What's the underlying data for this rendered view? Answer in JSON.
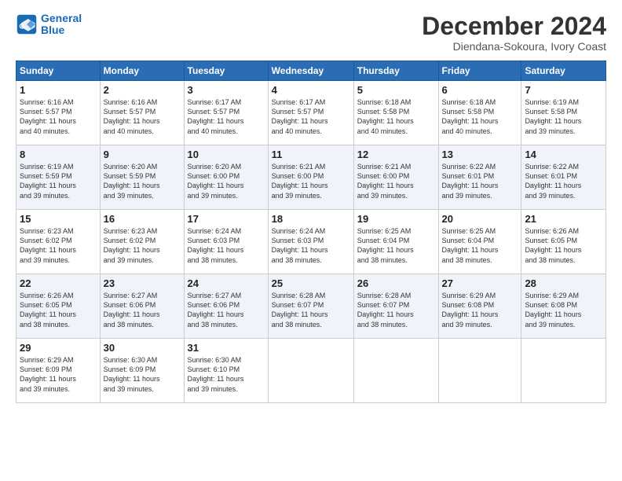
{
  "header": {
    "logo_line1": "General",
    "logo_line2": "Blue",
    "month_title": "December 2024",
    "location": "Diendana-Sokoura, Ivory Coast"
  },
  "weekdays": [
    "Sunday",
    "Monday",
    "Tuesday",
    "Wednesday",
    "Thursday",
    "Friday",
    "Saturday"
  ],
  "weeks": [
    [
      {
        "day": "1",
        "info": "Sunrise: 6:16 AM\nSunset: 5:57 PM\nDaylight: 11 hours\nand 40 minutes."
      },
      {
        "day": "2",
        "info": "Sunrise: 6:16 AM\nSunset: 5:57 PM\nDaylight: 11 hours\nand 40 minutes."
      },
      {
        "day": "3",
        "info": "Sunrise: 6:17 AM\nSunset: 5:57 PM\nDaylight: 11 hours\nand 40 minutes."
      },
      {
        "day": "4",
        "info": "Sunrise: 6:17 AM\nSunset: 5:57 PM\nDaylight: 11 hours\nand 40 minutes."
      },
      {
        "day": "5",
        "info": "Sunrise: 6:18 AM\nSunset: 5:58 PM\nDaylight: 11 hours\nand 40 minutes."
      },
      {
        "day": "6",
        "info": "Sunrise: 6:18 AM\nSunset: 5:58 PM\nDaylight: 11 hours\nand 40 minutes."
      },
      {
        "day": "7",
        "info": "Sunrise: 6:19 AM\nSunset: 5:58 PM\nDaylight: 11 hours\nand 39 minutes."
      }
    ],
    [
      {
        "day": "8",
        "info": "Sunrise: 6:19 AM\nSunset: 5:59 PM\nDaylight: 11 hours\nand 39 minutes."
      },
      {
        "day": "9",
        "info": "Sunrise: 6:20 AM\nSunset: 5:59 PM\nDaylight: 11 hours\nand 39 minutes."
      },
      {
        "day": "10",
        "info": "Sunrise: 6:20 AM\nSunset: 6:00 PM\nDaylight: 11 hours\nand 39 minutes."
      },
      {
        "day": "11",
        "info": "Sunrise: 6:21 AM\nSunset: 6:00 PM\nDaylight: 11 hours\nand 39 minutes."
      },
      {
        "day": "12",
        "info": "Sunrise: 6:21 AM\nSunset: 6:00 PM\nDaylight: 11 hours\nand 39 minutes."
      },
      {
        "day": "13",
        "info": "Sunrise: 6:22 AM\nSunset: 6:01 PM\nDaylight: 11 hours\nand 39 minutes."
      },
      {
        "day": "14",
        "info": "Sunrise: 6:22 AM\nSunset: 6:01 PM\nDaylight: 11 hours\nand 39 minutes."
      }
    ],
    [
      {
        "day": "15",
        "info": "Sunrise: 6:23 AM\nSunset: 6:02 PM\nDaylight: 11 hours\nand 39 minutes."
      },
      {
        "day": "16",
        "info": "Sunrise: 6:23 AM\nSunset: 6:02 PM\nDaylight: 11 hours\nand 39 minutes."
      },
      {
        "day": "17",
        "info": "Sunrise: 6:24 AM\nSunset: 6:03 PM\nDaylight: 11 hours\nand 38 minutes."
      },
      {
        "day": "18",
        "info": "Sunrise: 6:24 AM\nSunset: 6:03 PM\nDaylight: 11 hours\nand 38 minutes."
      },
      {
        "day": "19",
        "info": "Sunrise: 6:25 AM\nSunset: 6:04 PM\nDaylight: 11 hours\nand 38 minutes."
      },
      {
        "day": "20",
        "info": "Sunrise: 6:25 AM\nSunset: 6:04 PM\nDaylight: 11 hours\nand 38 minutes."
      },
      {
        "day": "21",
        "info": "Sunrise: 6:26 AM\nSunset: 6:05 PM\nDaylight: 11 hours\nand 38 minutes."
      }
    ],
    [
      {
        "day": "22",
        "info": "Sunrise: 6:26 AM\nSunset: 6:05 PM\nDaylight: 11 hours\nand 38 minutes."
      },
      {
        "day": "23",
        "info": "Sunrise: 6:27 AM\nSunset: 6:06 PM\nDaylight: 11 hours\nand 38 minutes."
      },
      {
        "day": "24",
        "info": "Sunrise: 6:27 AM\nSunset: 6:06 PM\nDaylight: 11 hours\nand 38 minutes."
      },
      {
        "day": "25",
        "info": "Sunrise: 6:28 AM\nSunset: 6:07 PM\nDaylight: 11 hours\nand 38 minutes."
      },
      {
        "day": "26",
        "info": "Sunrise: 6:28 AM\nSunset: 6:07 PM\nDaylight: 11 hours\nand 38 minutes."
      },
      {
        "day": "27",
        "info": "Sunrise: 6:29 AM\nSunset: 6:08 PM\nDaylight: 11 hours\nand 39 minutes."
      },
      {
        "day": "28",
        "info": "Sunrise: 6:29 AM\nSunset: 6:08 PM\nDaylight: 11 hours\nand 39 minutes."
      }
    ],
    [
      {
        "day": "29",
        "info": "Sunrise: 6:29 AM\nSunset: 6:09 PM\nDaylight: 11 hours\nand 39 minutes."
      },
      {
        "day": "30",
        "info": "Sunrise: 6:30 AM\nSunset: 6:09 PM\nDaylight: 11 hours\nand 39 minutes."
      },
      {
        "day": "31",
        "info": "Sunrise: 6:30 AM\nSunset: 6:10 PM\nDaylight: 11 hours\nand 39 minutes."
      },
      null,
      null,
      null,
      null
    ]
  ]
}
